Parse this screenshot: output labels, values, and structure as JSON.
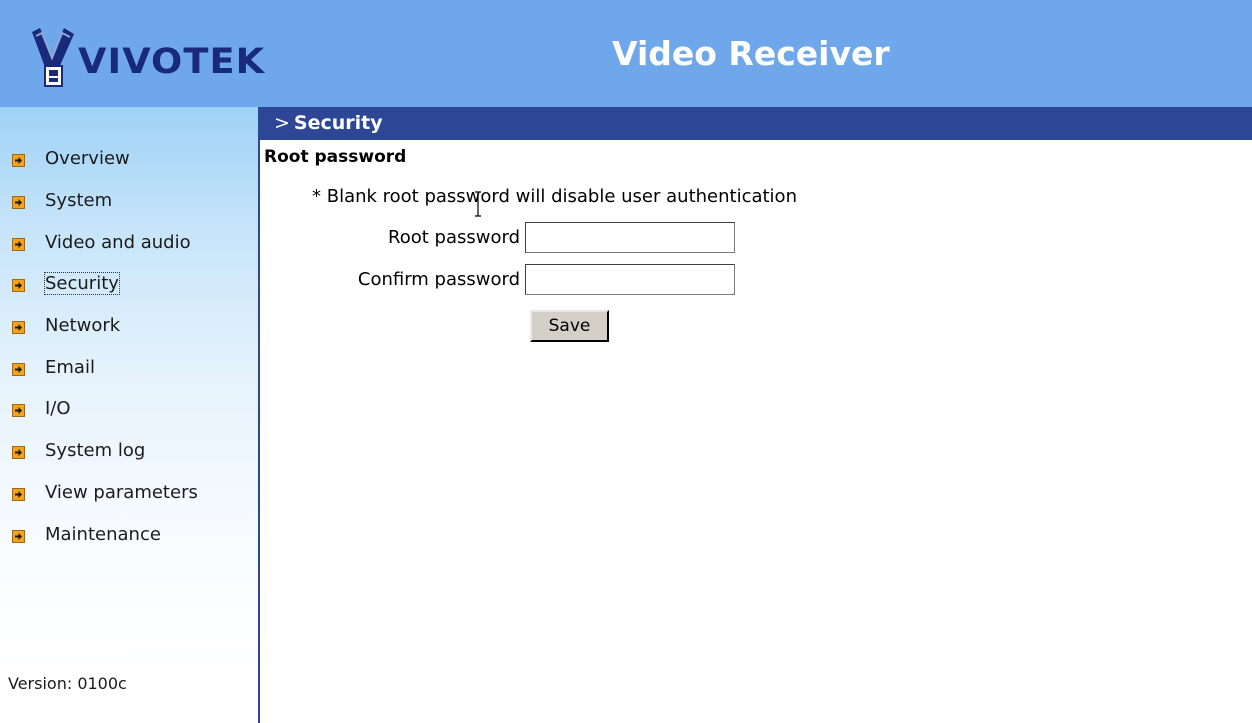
{
  "header": {
    "logo_text": "VIVOTEK",
    "app_title": "Video Receiver",
    "background_color": "#6fa8ea"
  },
  "sidebar": {
    "item_icon": "arrow-right-icon",
    "items": [
      {
        "label": "Overview",
        "active": false
      },
      {
        "label": "System",
        "active": false
      },
      {
        "label": "Video and audio",
        "active": false
      },
      {
        "label": "Security",
        "active": true
      },
      {
        "label": "Network",
        "active": false
      },
      {
        "label": "Email",
        "active": false
      },
      {
        "label": "I/O",
        "active": false
      },
      {
        "label": "System log",
        "active": false
      },
      {
        "label": "View parameters",
        "active": false
      },
      {
        "label": "Maintenance",
        "active": false
      }
    ],
    "version": "Version: 0100c"
  },
  "main": {
    "section_arrow": ">",
    "section_title": "Security",
    "section_bar_color": "#2d4796",
    "heading": "Root password",
    "note": "* Blank root password will disable user authentication",
    "fields": {
      "root_password_label": "Root password",
      "root_password_value": "",
      "confirm_password_label": "Confirm password",
      "confirm_password_value": ""
    },
    "save_label": "Save"
  }
}
